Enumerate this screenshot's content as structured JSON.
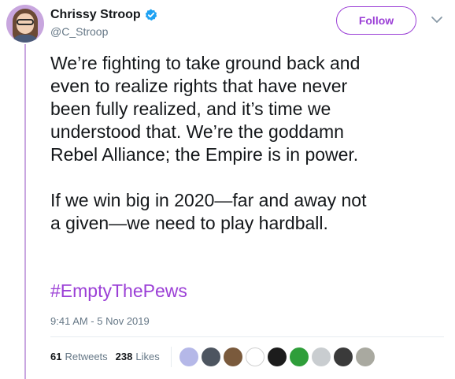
{
  "author": {
    "name": "Chrissy Stroop",
    "handle": "@C_Stroop",
    "verified": true
  },
  "follow_label": "Follow",
  "tweet": {
    "paragraphs": [
      "We’re fighting to take ground back and\neven to realize rights that have never\nbeen fully realized, and it’s time we\nunderstood that. We’re the goddamn\nRebel Alliance; the Empire is in power.",
      "If we win big in 2020—far and away not\na given—we need to play hardball."
    ],
    "hashtag": "#EmptyThePews",
    "timestamp": "9:41 AM - 5 Nov 2019"
  },
  "stats": {
    "retweets_count": "61",
    "retweets_label": "Retweets",
    "likes_count": "238",
    "likes_label": "Likes"
  },
  "colors": {
    "accent": "#9b3fd6",
    "thread_line": "#c9a7e0",
    "verified": "#1da1f2",
    "text": "#14171a",
    "muted": "#657786"
  },
  "likers": [
    {
      "icon": "liker-avatar-1",
      "color": "#b5b8e8"
    },
    {
      "icon": "liker-avatar-2",
      "color": "#4d5560"
    },
    {
      "icon": "liker-avatar-3",
      "color": "#7a5a3c"
    },
    {
      "icon": "liker-avatar-4",
      "color": "#ffffff"
    },
    {
      "icon": "liker-avatar-5",
      "color": "#1c1c1c"
    },
    {
      "icon": "liker-avatar-6",
      "color": "#2f9e3a"
    },
    {
      "icon": "liker-avatar-7",
      "color": "#c9cdd0"
    },
    {
      "icon": "liker-avatar-8",
      "color": "#3a3a3a"
    },
    {
      "icon": "liker-avatar-9",
      "color": "#a9a9a0"
    }
  ]
}
